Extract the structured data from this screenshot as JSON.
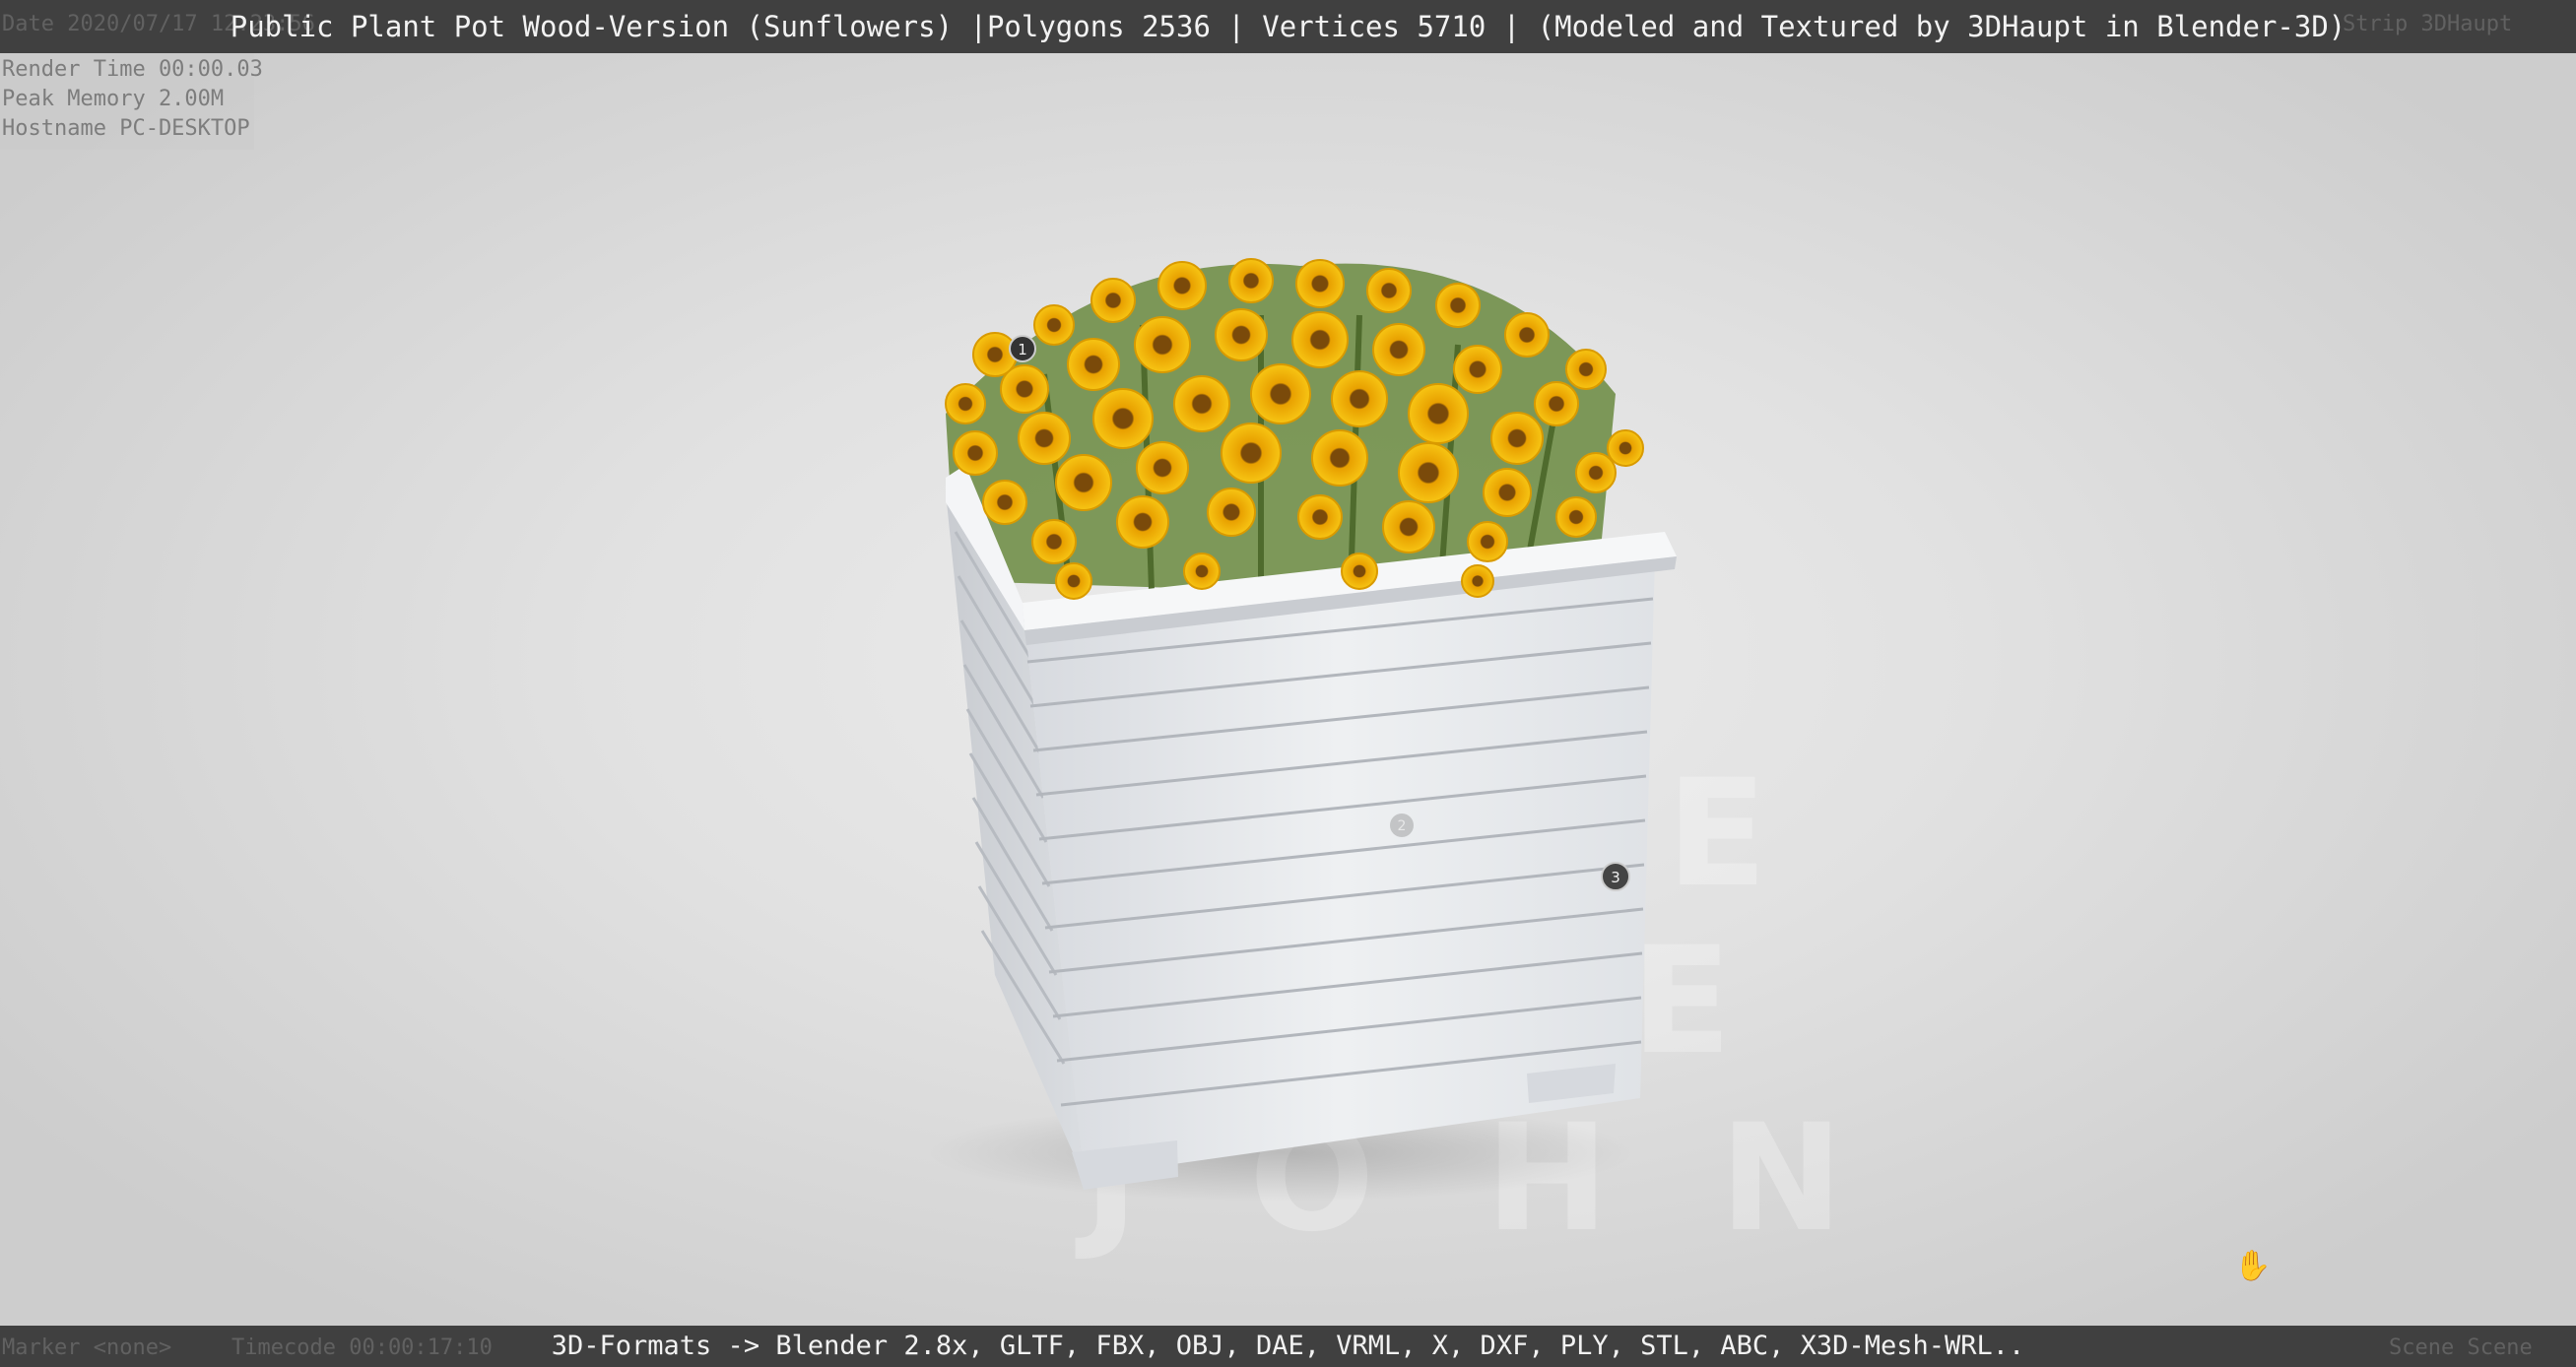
{
  "header": {
    "title": "Public Plant Pot Wood-Version (Sunflowers) |Polygons 2536 | Vertices 5710 | (Modeled and Textured by 3DHaupt in Blender-3D)"
  },
  "footer": {
    "formats": "3D-Formats -> Blender 2.8x, GLTF, FBX, OBJ, DAE, VRML, X, DXF, PLY, STL, ABC, X3D-Mesh-WRL.."
  },
  "overlay": {
    "date": "Date 2020/07/17 12:23:56",
    "render_time": "Render Time 00:00.03",
    "peak_memory": "Peak Memory 2.00M",
    "hostname": "Hostname PC-DESKTOP",
    "strip": "Strip 3DHaupt",
    "marker": "Marker <none>",
    "timecode": "Timecode 00:00:17:10",
    "scene": "Scene Scene"
  },
  "hotspots": [
    "1",
    "2",
    "3"
  ],
  "colors": {
    "bar": "#404040",
    "bar_text": "#f2f2f2",
    "background": "#e1e1e1",
    "petal": "#f2b705",
    "flower_center": "#7a4a0a",
    "stem": "#5d7a3a",
    "pot_wood": "#e9ebee"
  },
  "icons": {
    "cursor": "hand-grab-icon"
  }
}
